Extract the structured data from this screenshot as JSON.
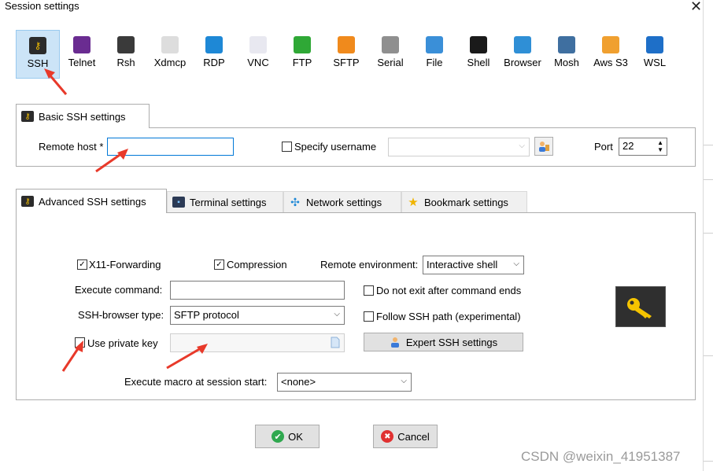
{
  "window": {
    "title": "Session settings",
    "close_glyph": "✕"
  },
  "protocols": [
    {
      "label": "SSH",
      "icon": "key-icon",
      "color": "#2b2b2b"
    },
    {
      "label": "Telnet",
      "icon": "telnet-icon",
      "color": "#6a2c91"
    },
    {
      "label": "Rsh",
      "icon": "rsh-icon",
      "color": "#3a3a3a"
    },
    {
      "label": "Xdmcp",
      "icon": "xdmcp-icon",
      "color": "#dddddd"
    },
    {
      "label": "RDP",
      "icon": "rdp-icon",
      "color": "#1e88d6"
    },
    {
      "label": "VNC",
      "icon": "vnc-icon",
      "color": "#e8e8f0"
    },
    {
      "label": "FTP",
      "icon": "ftp-icon",
      "color": "#2fa836"
    },
    {
      "label": "SFTP",
      "icon": "sftp-icon",
      "color": "#f08a1c"
    },
    {
      "label": "Serial",
      "icon": "serial-icon",
      "color": "#8f8f8f"
    },
    {
      "label": "File",
      "icon": "file-icon",
      "color": "#3a8fd8"
    },
    {
      "label": "Shell",
      "icon": "shell-icon",
      "color": "#1a1a1a"
    },
    {
      "label": "Browser",
      "icon": "browser-icon",
      "color": "#2f8fd6"
    },
    {
      "label": "Mosh",
      "icon": "mosh-icon",
      "color": "#3f6fa0"
    },
    {
      "label": "Aws S3",
      "icon": "aws-icon",
      "color": "#f0a030"
    },
    {
      "label": "WSL",
      "icon": "wsl-icon",
      "color": "#1e6fc8"
    }
  ],
  "basic": {
    "tab_label": "Basic SSH settings",
    "remote_host_label": "Remote host *",
    "remote_host_value": "",
    "specify_username_label": "Specify username",
    "username_value": "",
    "port_label": "Port",
    "port_value": "22"
  },
  "tabs": [
    {
      "label": "Advanced SSH settings",
      "icon": "key-icon",
      "active": true
    },
    {
      "label": "Terminal settings",
      "icon": "terminal-icon",
      "active": false
    },
    {
      "label": "Network settings",
      "icon": "network-icon",
      "active": false
    },
    {
      "label": "Bookmark settings",
      "icon": "star-icon",
      "active": false
    }
  ],
  "advanced": {
    "x11_label": "X11-Forwarding",
    "x11_checked": true,
    "compression_label": "Compression",
    "compression_checked": true,
    "remote_env_label": "Remote environment:",
    "remote_env_value": "Interactive shell",
    "execute_command_label": "Execute command:",
    "execute_command_value": "",
    "do_not_exit_label": "Do not exit after command ends",
    "do_not_exit_checked": false,
    "ssh_browser_label": "SSH-browser type:",
    "ssh_browser_value": "SFTP protocol",
    "follow_path_label": "Follow SSH path (experimental)",
    "follow_path_checked": false,
    "private_key_label": "Use private key",
    "private_key_checked": false,
    "private_key_value": "",
    "expert_button_label": "Expert SSH settings",
    "macro_label": "Execute macro at session start:",
    "macro_value": "<none>"
  },
  "buttons": {
    "ok_label": "OK",
    "cancel_label": "Cancel"
  },
  "watermark": "CSDN @weixin_41951387",
  "colors": {
    "selection": "#cce4f7",
    "focus_border": "#0078d7",
    "annotation_arrow": "#e8392a",
    "ok_green": "#2fa84f",
    "cancel_red": "#e03131"
  }
}
